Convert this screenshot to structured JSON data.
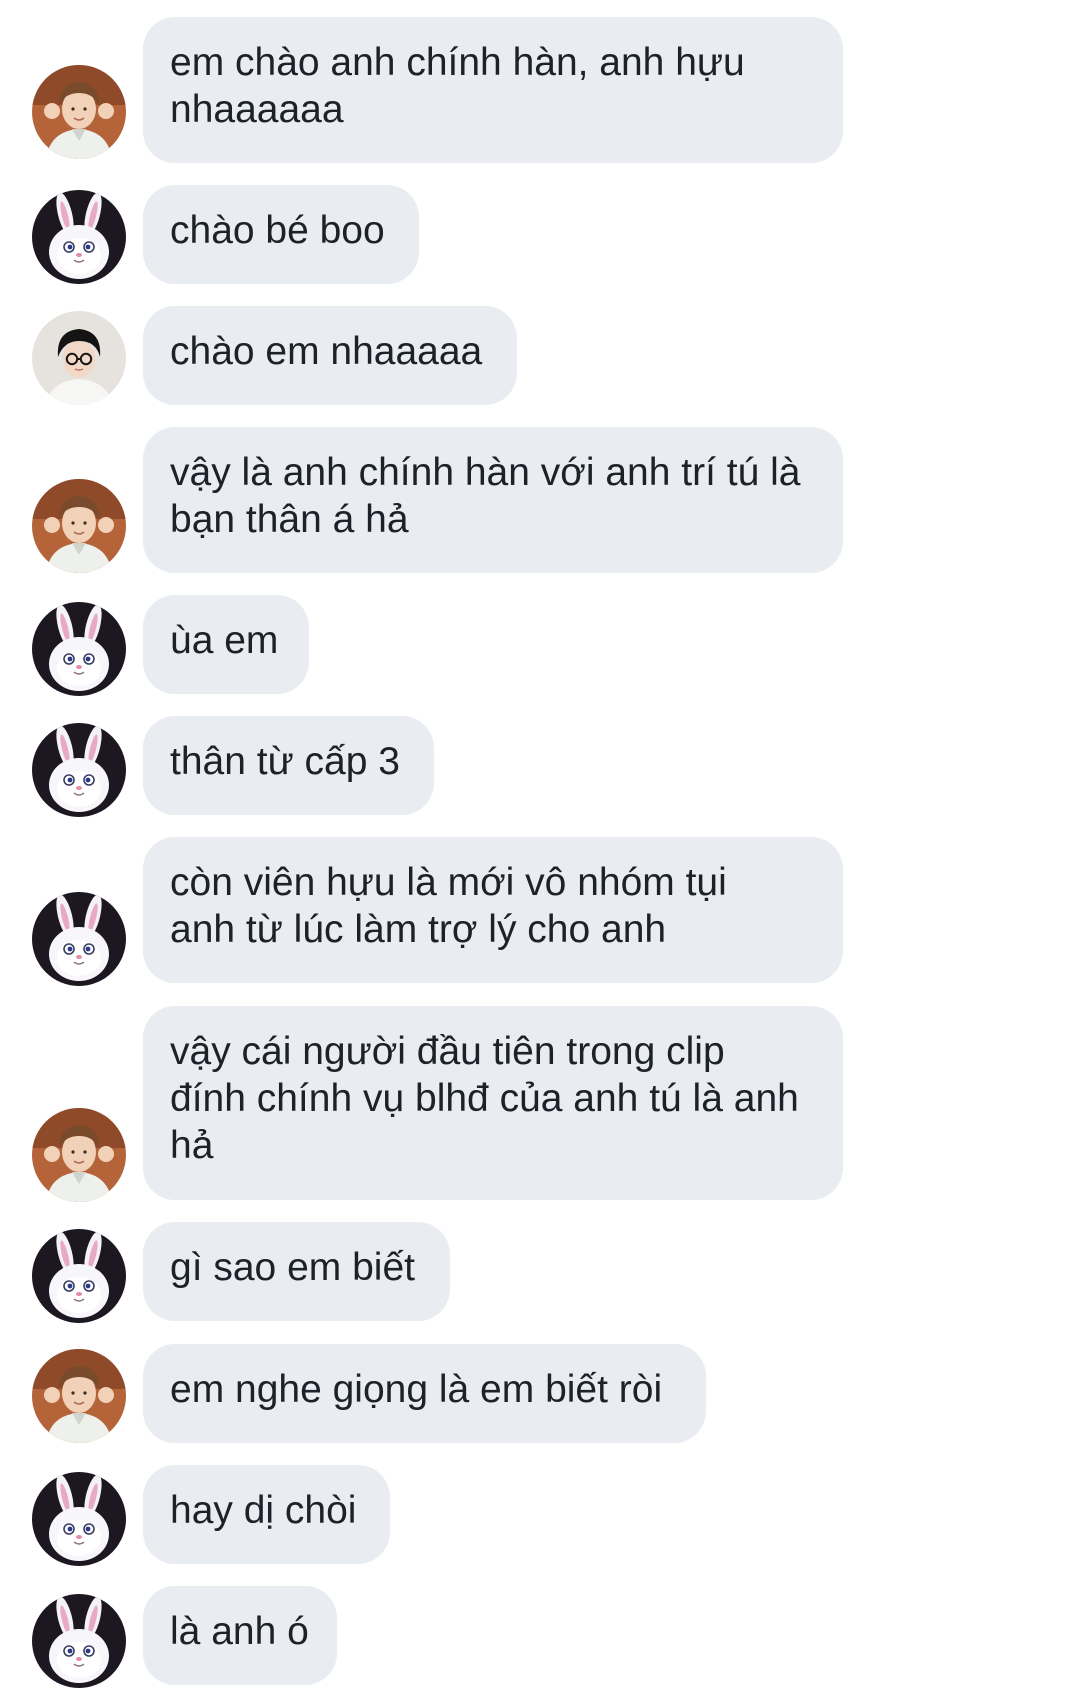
{
  "conversation": {
    "messages": [
      {
        "sender": "boy-photo",
        "avatar_icon": "boy-photo-avatar-icon",
        "text": "em chào anh chính hàn, anh hựu\nnhaaaaaa"
      },
      {
        "sender": "bunny",
        "avatar_icon": "bunny-avatar-icon",
        "text": "chào bé boo"
      },
      {
        "sender": "glasses-boy",
        "avatar_icon": "glasses-boy-avatar-icon",
        "text": "chào em nhaaaaa"
      },
      {
        "sender": "boy-photo",
        "avatar_icon": "boy-photo-avatar-icon",
        "text": "vậy là anh chính hàn với anh trí tú là\nbạn thân á hả"
      },
      {
        "sender": "bunny",
        "avatar_icon": "bunny-avatar-icon",
        "text": "ùa em"
      },
      {
        "sender": "bunny",
        "avatar_icon": "bunny-avatar-icon",
        "text": "thân từ cấp 3"
      },
      {
        "sender": "bunny",
        "avatar_icon": "bunny-avatar-icon",
        "text": "còn viên hựu là mới vô nhóm tụi\nanh từ lúc làm trợ lý cho anh"
      },
      {
        "sender": "boy-photo",
        "avatar_icon": "boy-photo-avatar-icon",
        "text": "vậy cái người đầu tiên trong clip\nđính chính vụ blhđ của anh tú là anh\nhả"
      },
      {
        "sender": "bunny",
        "avatar_icon": "bunny-avatar-icon",
        "text": "gì sao em biết"
      },
      {
        "sender": "boy-photo",
        "avatar_icon": "boy-photo-avatar-icon",
        "text": "em nghe giọng là em biết ròi"
      },
      {
        "sender": "bunny",
        "avatar_icon": "bunny-avatar-icon",
        "text": "hay dị chòi"
      },
      {
        "sender": "bunny",
        "avatar_icon": "bunny-avatar-icon",
        "text": "là anh ó"
      }
    ]
  },
  "colors": {
    "bubble_bg": "#e9ecf1",
    "text": "#1d2129",
    "background": "#ffffff"
  }
}
